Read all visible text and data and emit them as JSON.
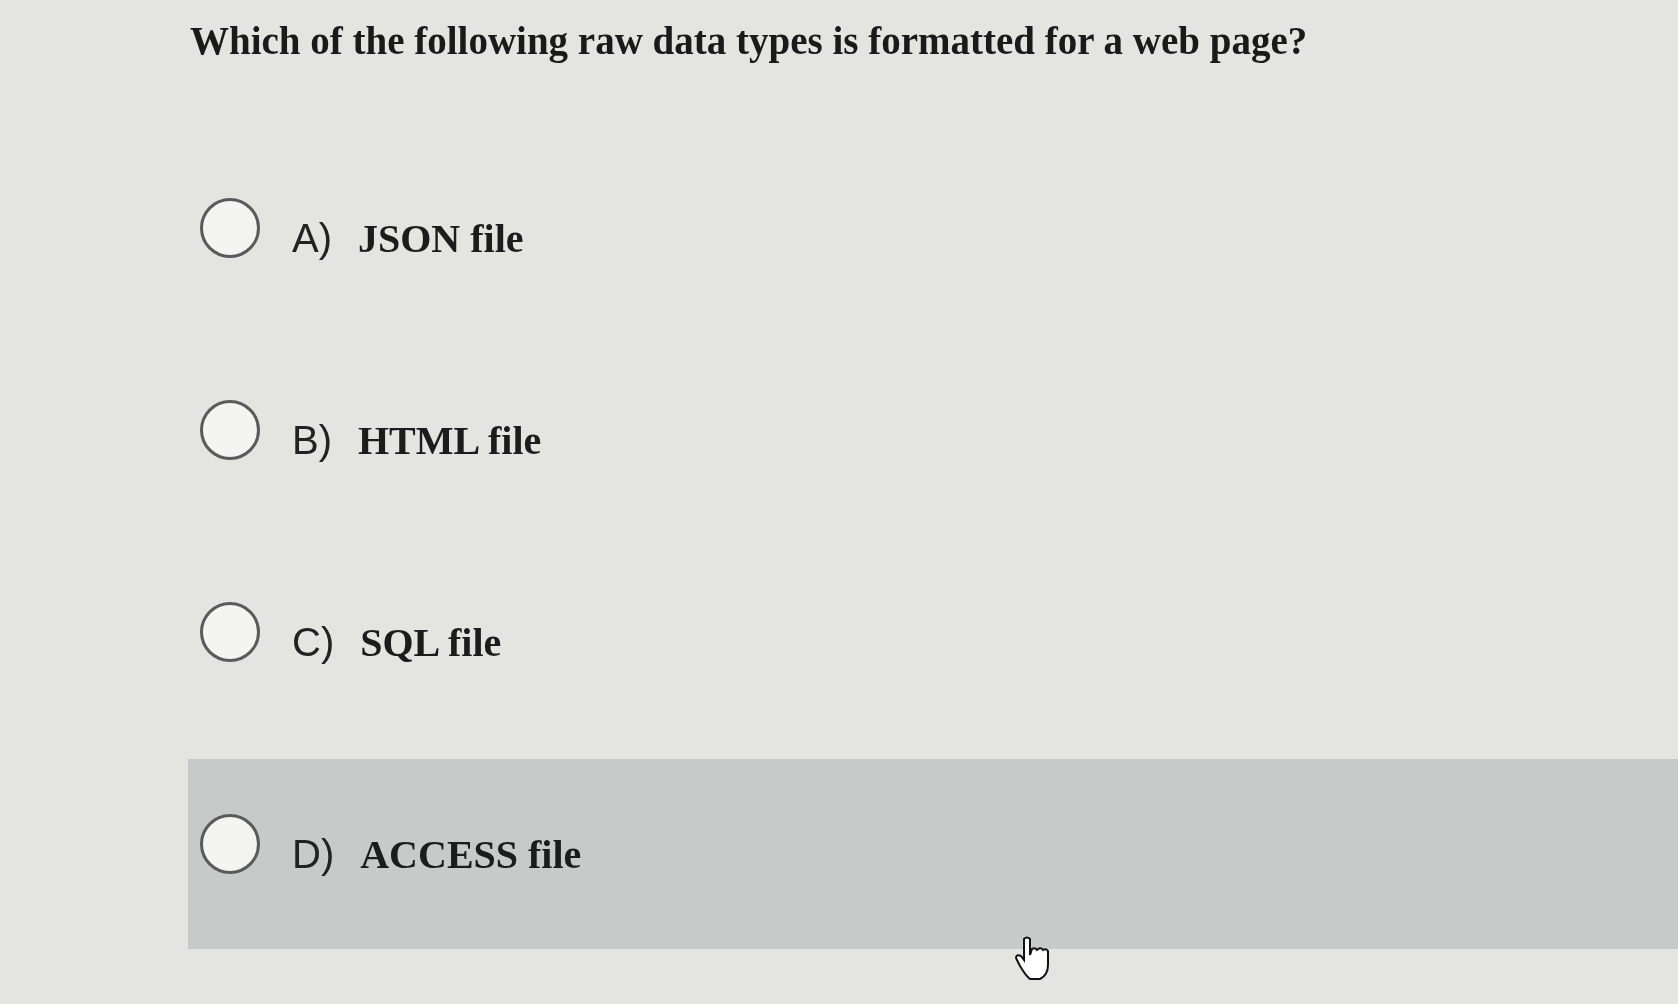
{
  "question": "Which of the following raw data types is formatted for a web page?",
  "options": [
    {
      "letter": "A)",
      "text": "JSON file",
      "selected": false,
      "hovered": false
    },
    {
      "letter": "B)",
      "text": "HTML file",
      "selected": false,
      "hovered": false
    },
    {
      "letter": "C)",
      "text": "SQL file",
      "selected": false,
      "hovered": false
    },
    {
      "letter": "D)",
      "text": "ACCESS file",
      "selected": false,
      "hovered": true
    }
  ]
}
